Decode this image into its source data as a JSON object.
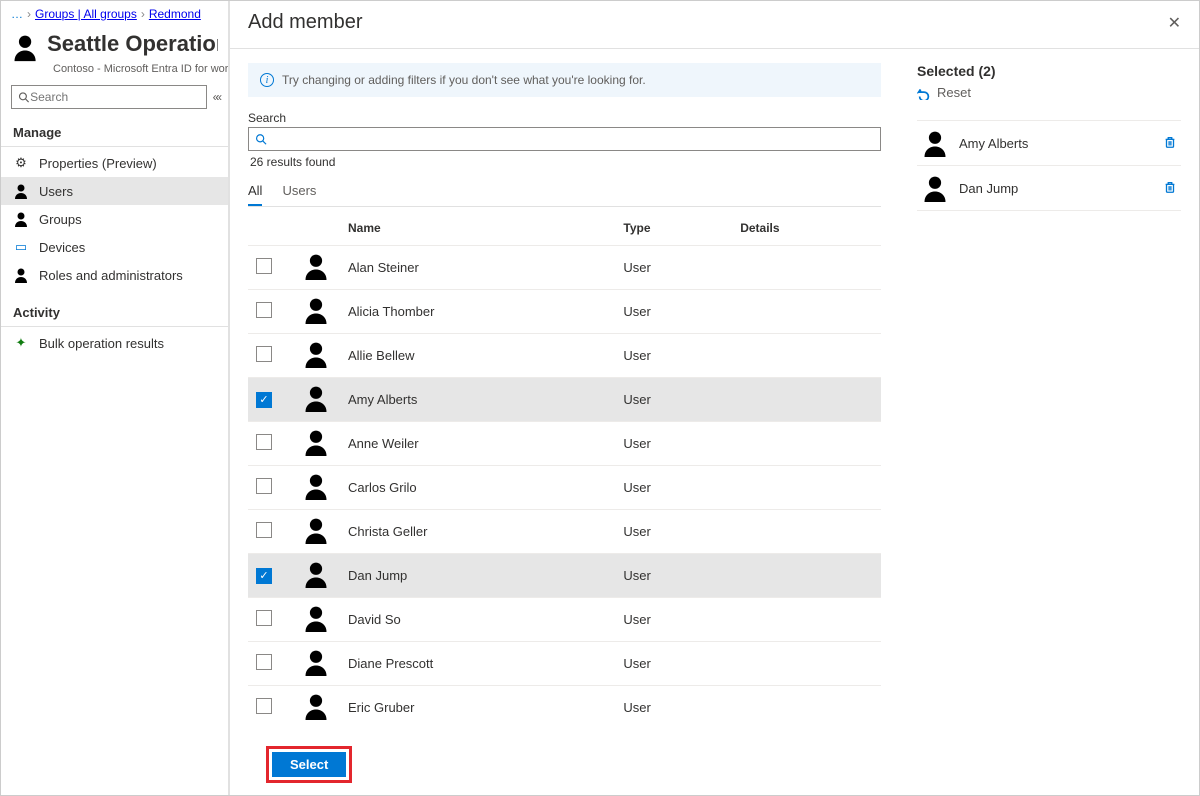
{
  "breadcrumbs": {
    "ellipsis": "…",
    "item1": "Groups | All groups",
    "item2": "Redmond"
  },
  "page": {
    "title": "Seattle Operations",
    "subtitle": "Contoso - Microsoft Entra ID for workforce"
  },
  "sidebar_search": {
    "placeholder": "Search"
  },
  "sections": {
    "manage": "Manage",
    "activity": "Activity"
  },
  "nav": {
    "properties": "Properties (Preview)",
    "users": "Users",
    "groups": "Groups",
    "devices": "Devices",
    "roles": "Roles and administrators",
    "bulk": "Bulk operation results"
  },
  "overlay": {
    "title": "Add member"
  },
  "banner": {
    "text": "Try changing or adding filters if you don't see what you're looking for."
  },
  "search": {
    "label": "Search",
    "results": "26 results found"
  },
  "tabs": {
    "all": "All",
    "users": "Users"
  },
  "columns": {
    "name": "Name",
    "type": "Type",
    "details": "Details"
  },
  "rows": [
    {
      "name": "Alan Steiner",
      "type": "User",
      "checked": false
    },
    {
      "name": "Alicia Thomber",
      "type": "User",
      "checked": false
    },
    {
      "name": "Allie Bellew",
      "type": "User",
      "checked": false
    },
    {
      "name": "Amy Alberts",
      "type": "User",
      "checked": true
    },
    {
      "name": "Anne Weiler",
      "type": "User",
      "checked": false
    },
    {
      "name": "Carlos Grilo",
      "type": "User",
      "checked": false
    },
    {
      "name": "Christa Geller",
      "type": "User",
      "checked": false
    },
    {
      "name": "Dan Jump",
      "type": "User",
      "checked": true
    },
    {
      "name": "David So",
      "type": "User",
      "checked": false
    },
    {
      "name": "Diane Prescott",
      "type": "User",
      "checked": false
    },
    {
      "name": "Eric Gruber",
      "type": "User",
      "checked": false
    }
  ],
  "selected": {
    "header": "Selected (2)",
    "reset": "Reset",
    "items": [
      {
        "name": "Amy Alberts"
      },
      {
        "name": "Dan Jump"
      }
    ]
  },
  "footer": {
    "select": "Select"
  }
}
